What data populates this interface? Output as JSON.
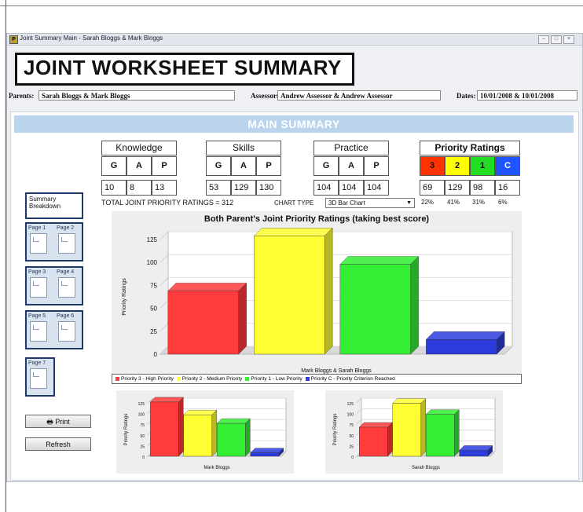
{
  "window": {
    "title": "Joint Summary Main - Sarah Bloggs & Mark Bloggs",
    "app_icon": "P",
    "buttons": [
      "minimize-icon",
      "maximize-icon",
      "close-icon"
    ]
  },
  "banner": {
    "title": "JOINT WORKSHEET SUMMARY"
  },
  "info": {
    "parents_label": "Parents:",
    "parents_value": "Sarah Bloggs & Mark Bloggs",
    "assessors_label": "Assessors:",
    "assessors_value": "Andrew Assessor & Andrew Assessor",
    "dates_label": "Dates:",
    "dates_value": "10/01/2008 & 10/01/2008"
  },
  "main": {
    "header": "MAIN SUMMARY",
    "groups": [
      {
        "title": "Knowledge",
        "cols": [
          "G",
          "A",
          "P"
        ],
        "values": [
          "10",
          "8",
          "13"
        ]
      },
      {
        "title": "Skills",
        "cols": [
          "G",
          "A",
          "P"
        ],
        "values": [
          "53",
          "129",
          "130"
        ]
      },
      {
        "title": "Practice",
        "cols": [
          "G",
          "A",
          "P"
        ],
        "values": [
          "104",
          "104",
          "104"
        ]
      }
    ],
    "priority": {
      "title": "Priority Ratings",
      "cols": [
        "3",
        "2",
        "1",
        "C"
      ],
      "colors": [
        "#ff3300",
        "#ffff00",
        "#22dd22",
        "#1f55ff"
      ],
      "values": [
        "69",
        "129",
        "98",
        "16"
      ],
      "percents": [
        "22%",
        "41%",
        "31%",
        "6%"
      ]
    },
    "totals_text": "TOTAL JOINT PRIORITY RATINGS = 312",
    "chart_type_label": "CHART TYPE",
    "chart_type_value": "3D Bar Chart"
  },
  "sidebar": {
    "summary_breakdown": "Summary Breakdown",
    "pages": [
      "Page 1",
      "Page 2",
      "Page 3",
      "Page 4",
      "Page 5",
      "Page 6",
      "Page 7"
    ],
    "print_label": "Print",
    "refresh_label": "Refresh"
  },
  "chart_data": [
    {
      "type": "bar",
      "title": "Both Parent's Joint Priority Ratings (taking best score)",
      "xlabel": "Mark Bloggs & Sarah Bloggs",
      "ylabel": "Priority Ratings",
      "ylim": [
        0,
        125
      ],
      "yticks": [
        "0",
        "25",
        "50",
        "75",
        "100",
        "125"
      ],
      "series": [
        {
          "name": "Priority 3 - High Priority",
          "color": "#ff3b3b",
          "values": [
            69
          ]
        },
        {
          "name": "Priority 2 - Medium Priority",
          "color": "#ffff33",
          "values": [
            129
          ]
        },
        {
          "name": "Priority 1 - Low Priority",
          "color": "#33ee33",
          "values": [
            98
          ]
        },
        {
          "name": "Priority C - Priority Criterion Reached",
          "color": "#2b3bdd",
          "values": [
            16
          ]
        }
      ],
      "legend": "bottom",
      "grid": true
    },
    {
      "type": "bar",
      "title": "",
      "xlabel": "Mark Bloggs",
      "ylabel": "Priority Ratings",
      "ylim": [
        0,
        125
      ],
      "yticks": [
        "0",
        "25",
        "50",
        "75",
        "100",
        "125"
      ],
      "series": [
        {
          "name": "Priority 3 - High Priority",
          "color": "#ff3b3b",
          "values": [
            127
          ]
        },
        {
          "name": "Priority 2 - Medium Priority",
          "color": "#ffff33",
          "values": [
            97
          ]
        },
        {
          "name": "Priority 1 - Low Priority",
          "color": "#33ee33",
          "values": [
            77
          ]
        },
        {
          "name": "Priority C - Priority Criterion Reached",
          "color": "#2b3bdd",
          "values": [
            8
          ]
        }
      ]
    },
    {
      "type": "bar",
      "title": "",
      "xlabel": "Sarah Bloggs",
      "ylabel": "Priority Ratings",
      "ylim": [
        0,
        125
      ],
      "yticks": [
        "0",
        "25",
        "50",
        "75",
        "100",
        "125"
      ],
      "series": [
        {
          "name": "Priority 3 - High Priority",
          "color": "#ff3b3b",
          "values": [
            68
          ]
        },
        {
          "name": "Priority 2 - Medium Priority",
          "color": "#ffff33",
          "values": [
            124
          ]
        },
        {
          "name": "Priority 1 - Low Priority",
          "color": "#33ee33",
          "values": [
            98
          ]
        },
        {
          "name": "Priority C - Priority Criterion Reached",
          "color": "#2b3bdd",
          "values": [
            14
          ]
        }
      ]
    }
  ]
}
